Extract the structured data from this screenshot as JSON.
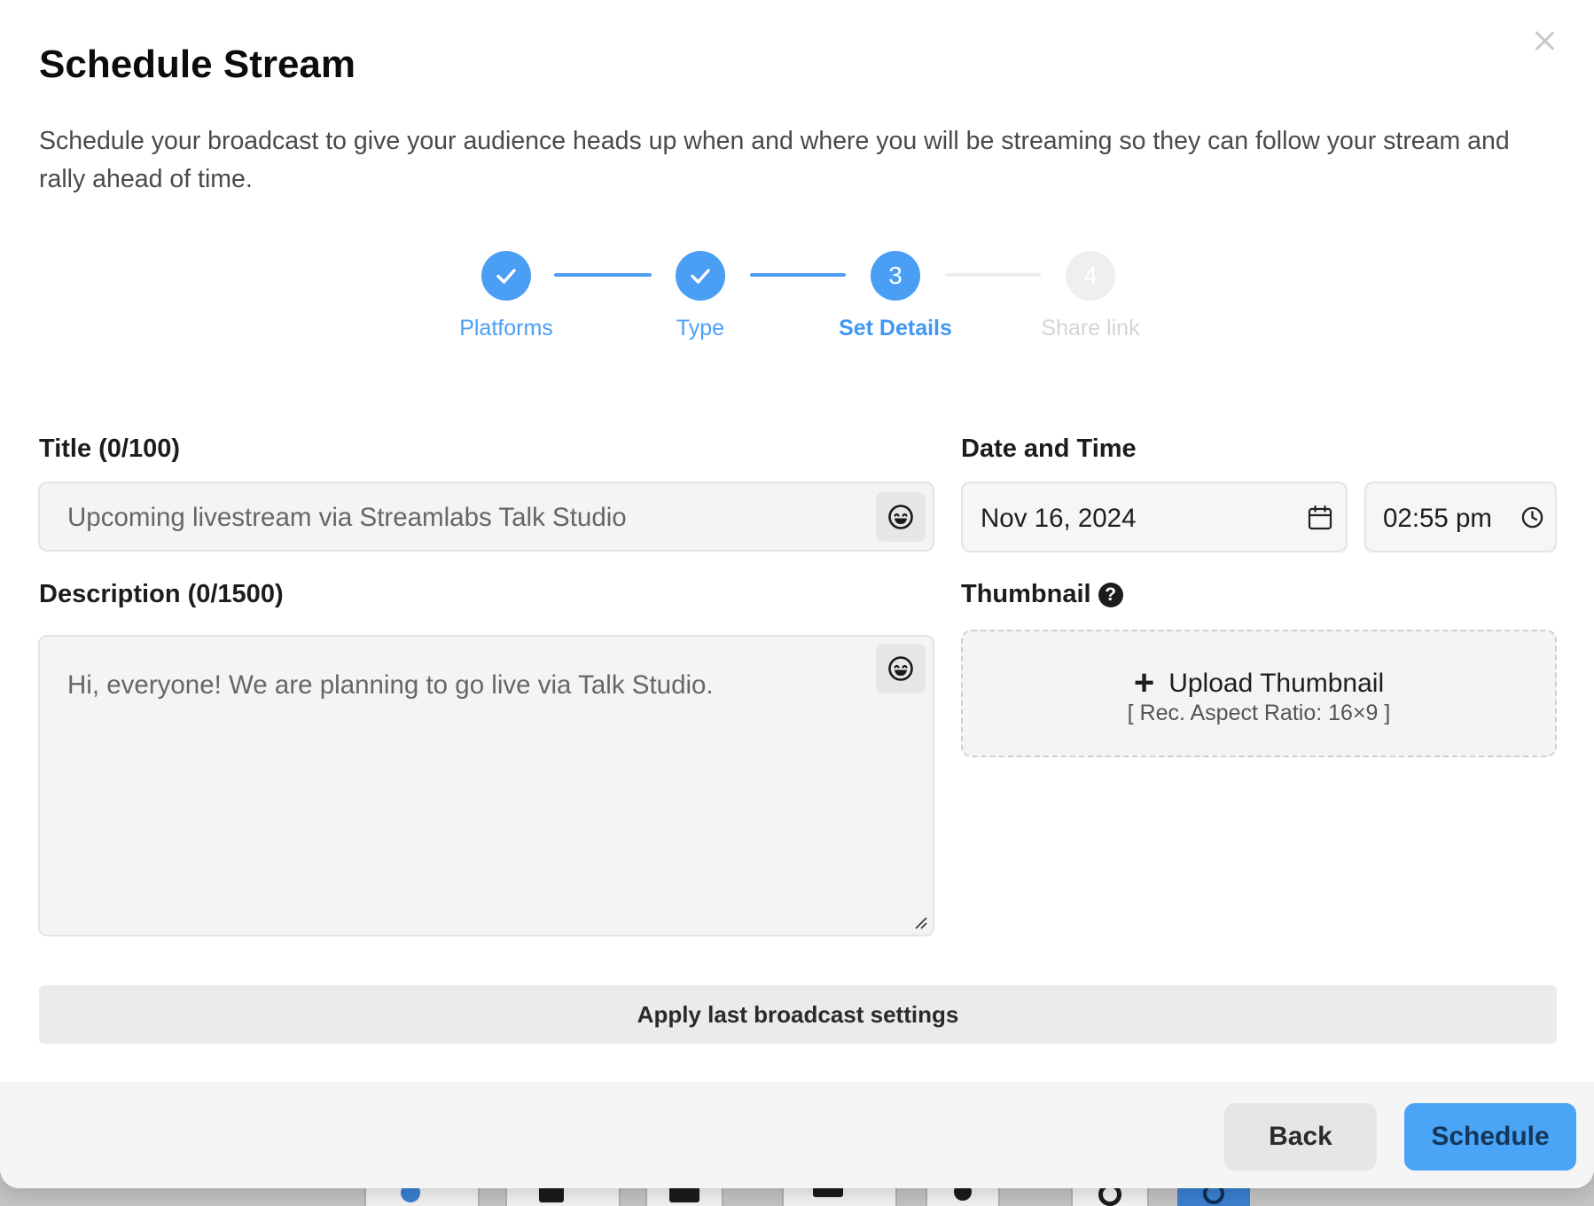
{
  "dialog": {
    "title": "Schedule Stream",
    "description": "Schedule your broadcast to give your audience heads up when and where you will be streaming so they can follow your stream and rally ahead of time."
  },
  "stepper": {
    "steps": [
      {
        "number": "1",
        "label": "Platforms",
        "state": "done"
      },
      {
        "number": "2",
        "label": "Type",
        "state": "done"
      },
      {
        "number": "3",
        "label": "Set Details",
        "state": "active"
      },
      {
        "number": "4",
        "label": "Share link",
        "state": "pending"
      }
    ]
  },
  "form": {
    "title_label": "Title (0/100)",
    "title_placeholder": "Upcoming livestream via Streamlabs Talk Studio",
    "description_label": "Description (0/1500)",
    "description_placeholder": "Hi, everyone! We are planning to go live via Talk Studio.",
    "datetime_label": "Date and Time",
    "date_value": "Nov 16, 2024",
    "time_value": "02:55 pm",
    "thumbnail_label": "Thumbnail",
    "thumbnail_help": "?",
    "upload_label": "Upload Thumbnail",
    "upload_hint": "[ Rec. Aspect Ratio: 16×9 ]",
    "apply_label": "Apply last broadcast settings"
  },
  "footer": {
    "back_label": "Back",
    "schedule_label": "Schedule"
  },
  "colors": {
    "accent": "#4a9ff5",
    "pending": "#efefef"
  },
  "icons": {
    "close": "close-icon",
    "check": "check-icon",
    "emoji": "smile-icon",
    "calendar": "calendar-icon",
    "clock": "clock-icon",
    "help": "help-icon",
    "plus": "plus-icon"
  }
}
